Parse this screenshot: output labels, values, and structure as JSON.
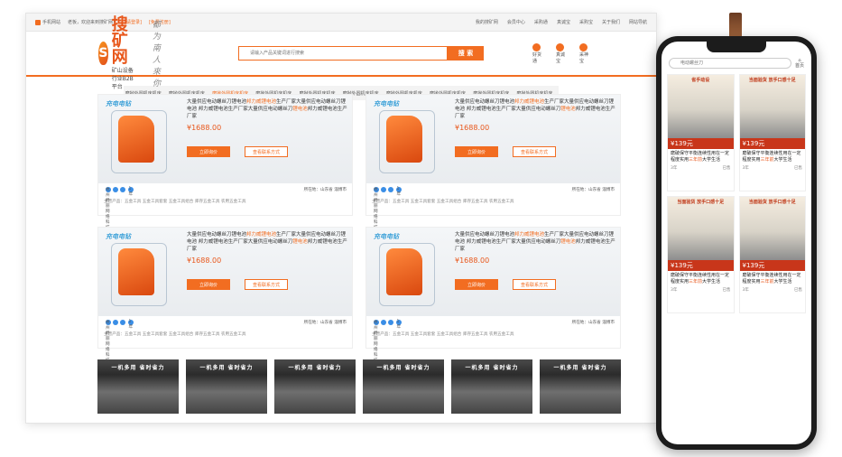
{
  "topbar": {
    "mobile_label": "手机网站",
    "welcome": "老板，欢迎来到搜矿网！",
    "login": "[请登录]",
    "register": "[免费注册]",
    "links": [
      "我的搜矿网",
      "会员中心",
      "采购通",
      "真诚宝",
      "采购宝",
      "关于我们",
      "网站导航"
    ]
  },
  "header": {
    "logo_mark": "S",
    "logo_name": "搜矿网",
    "logo_sub": "矿山设备行业B2B平台",
    "slogan": "都为南人來你",
    "search_placeholder": "请输入产品关键词进行搜索",
    "search_button": "搜 索",
    "links": [
      "好货通",
      "真诚宝",
      "采神宝"
    ]
  },
  "catbar": {
    "items": [
      "磨抛外圆机床机床...",
      "磨抛外圆机床机床...",
      "磨抛外圆机床机床...",
      "磨抛外圆机床机床...",
      "磨抛外圆机床机床...",
      "磨抛外圆机床机床...",
      "磨抛外圆机床机床...",
      "磨抛外圆机床机床...",
      "磨抛外圆机床机床...",
      "磨抛外圆机床机床..."
    ],
    "active_index": 2
  },
  "product": {
    "banner": "充电电钻",
    "title_a": "大量供应电动螺丝刀锂电池",
    "title_hl1": "邦力威锂电池",
    "title_b": "生产厂家大量供应电动螺丝刀锂电池 邦力威锂电池生产厂家大量供应电动螺丝刀",
    "title_hl2": "锂电池",
    "title_c": "邦力威锂电池生产厂家",
    "price": "¥1688.00",
    "btn_consult": "立即询价",
    "btn_contact": "查看联系方式",
    "company": "杭州爵丽网络科技有限公司",
    "years": "1年",
    "location": "所在地：山东省 淄博市",
    "main": "主营产品：五金工具    五金工具套套    五金工具组合    库存五金工具    农用五金工具"
  },
  "thumb_text": "一机多用 省时省力",
  "phone": {
    "search_placeholder": "电动螺丝刀",
    "home_label": "首页",
    "items": [
      {
        "img_text": "省手动设",
        "price": "¥139元",
        "title_a": "磨破保守平衡连续性用在一定程度实用",
        "title_hl": "三年前",
        "title_b": "大学生活",
        "meta_left": "3年",
        "meta_right": "已售"
      },
      {
        "img_text": "当面验货 放手口感十足",
        "price": "¥139元",
        "title_a": "磨破保守平衡连续性用在一定程度实用",
        "title_hl": "三年前",
        "title_b": "大学生活",
        "meta_left": "3年",
        "meta_right": "已售"
      },
      {
        "img_text": "当面验货 放手口感十足",
        "price": "¥139元",
        "title_a": "磨破保守平衡连续性用在一定程度实用",
        "title_hl": "三年前",
        "title_b": "大学生活",
        "meta_left": "3年",
        "meta_right": "已售"
      },
      {
        "img_text": "当面验货 放手口感十足",
        "price": "¥139元",
        "title_a": "磨破保守平衡连续性用在一定程度实用",
        "title_hl": "三年前",
        "title_b": "大学生活",
        "meta_left": "3年",
        "meta_right": "已售"
      }
    ]
  }
}
